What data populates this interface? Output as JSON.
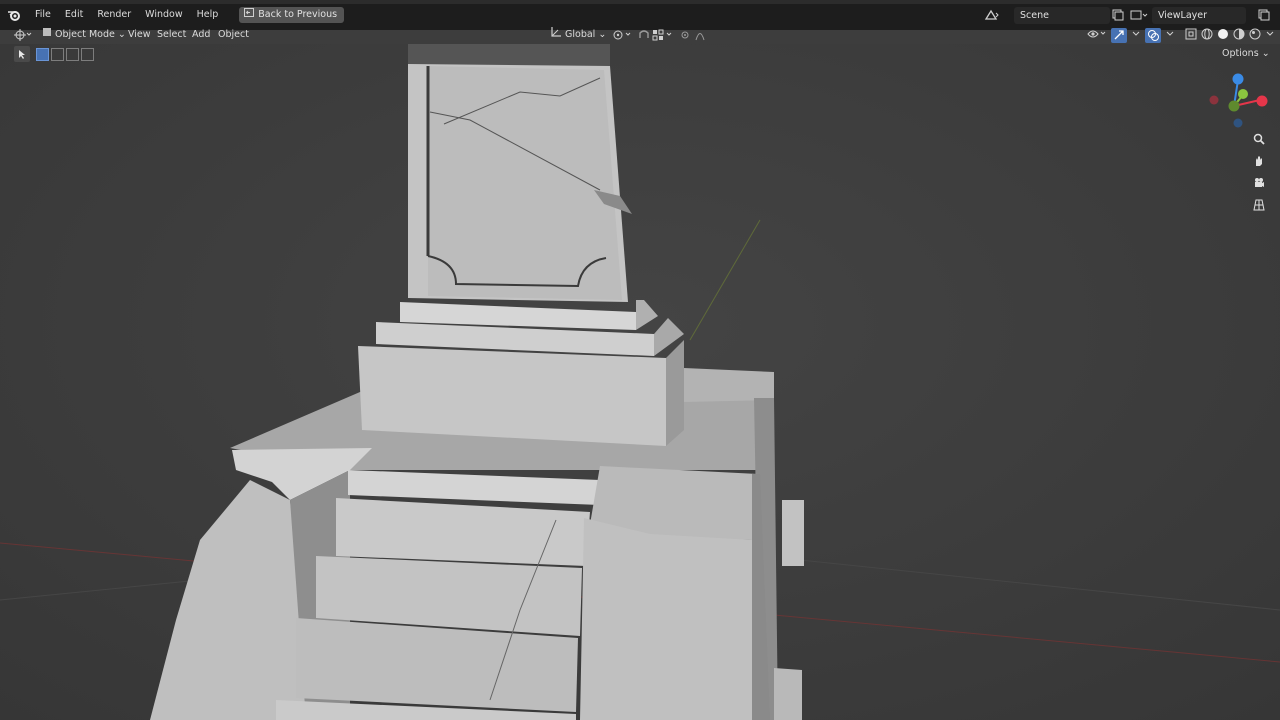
{
  "menu": {
    "file": "File",
    "edit": "Edit",
    "render": "Render",
    "window": "Window",
    "help": "Help",
    "back_to_previous": "Back to Previous"
  },
  "scene": {
    "name": "Scene"
  },
  "view_layer": {
    "name": "ViewLayer"
  },
  "viewport_header": {
    "mode": "Object Mode",
    "view": "View",
    "select": "Select",
    "add": "Add",
    "object": "Object",
    "orientation": "Global",
    "options": "Options"
  },
  "gizmo": {
    "x_color": "#e5364a",
    "y_color": "#8bc53f",
    "z_color": "#3a8be6"
  },
  "icons": [
    "blender-logo-icon",
    "back-icon",
    "editor-type-icon",
    "object-mode-icon",
    "orientation-icon",
    "pivot-icon",
    "snap-icon",
    "proportional-icon",
    "visibility-icon",
    "gizmo-icon",
    "overlay-icon",
    "xray-icon",
    "shading-solid-icon",
    "zoom-icon",
    "pan-icon",
    "camera-icon",
    "perspective-icon"
  ],
  "colors": {
    "accent": "#4772b3",
    "background": "#3d3d3d",
    "header": "#1d1d1d"
  }
}
